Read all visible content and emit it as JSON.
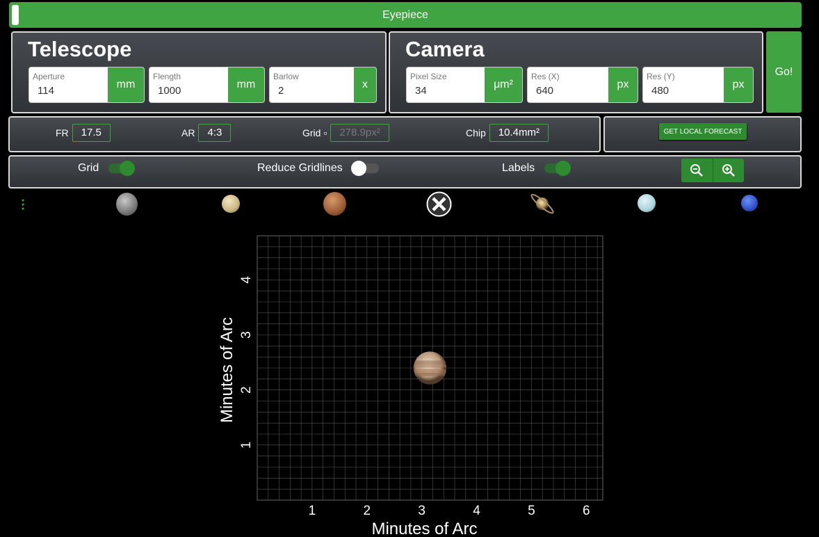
{
  "topbar": {
    "title": "Eyepiece"
  },
  "telescope": {
    "title": "Telescope",
    "aperture": {
      "label": "Aperture",
      "value": "114",
      "unit": "mm"
    },
    "flength": {
      "label": "Flength",
      "value": "1000",
      "unit": "mm"
    },
    "barlow": {
      "label": "Barlow",
      "value": "2",
      "unit": "x"
    }
  },
  "camera": {
    "title": "Camera",
    "pixel_size": {
      "label": "Pixel Size",
      "value": "34",
      "unit": "μm²"
    },
    "res_x": {
      "label": "Res (X)",
      "value": "640",
      "unit": "px"
    },
    "res_y": {
      "label": "Res (Y)",
      "value": "480",
      "unit": "px"
    }
  },
  "go_label": "Go!",
  "stats": {
    "fr_label": "FR",
    "fr_value": "17.5",
    "ar_label": "AR",
    "ar_value": "4:3",
    "grid_label": "Grid ▫",
    "grid_value": "278.9px²",
    "chip_label": "Chip",
    "chip_value": "10.4mm²"
  },
  "forecast_label": "GET LOCAL FORECAST",
  "toggles": {
    "grid_label": "Grid",
    "grid_on": true,
    "reduce_label": "Reduce Gridlines",
    "reduce_on": false,
    "labels_label": "Labels",
    "labels_on": true
  },
  "planets": [
    "mercury",
    "venus",
    "mars",
    "close",
    "saturn",
    "uranus",
    "neptune"
  ],
  "colors": {
    "accent": "#3fa441",
    "panel": "#3a3d42",
    "grid": "#555555"
  },
  "chart_data": {
    "type": "scatter",
    "xlabel": "Minutes of Arc",
    "ylabel": "Minutes of Arc",
    "xlim": [
      0,
      6.3
    ],
    "ylim": [
      0,
      4.8
    ],
    "xticks": [
      1,
      2,
      3,
      4,
      5,
      6
    ],
    "yticks": [
      1,
      2,
      3,
      4
    ],
    "grid": true,
    "objects": [
      {
        "name": "jupiter",
        "x": 3.15,
        "y": 2.4,
        "diameter": 0.6
      }
    ]
  }
}
